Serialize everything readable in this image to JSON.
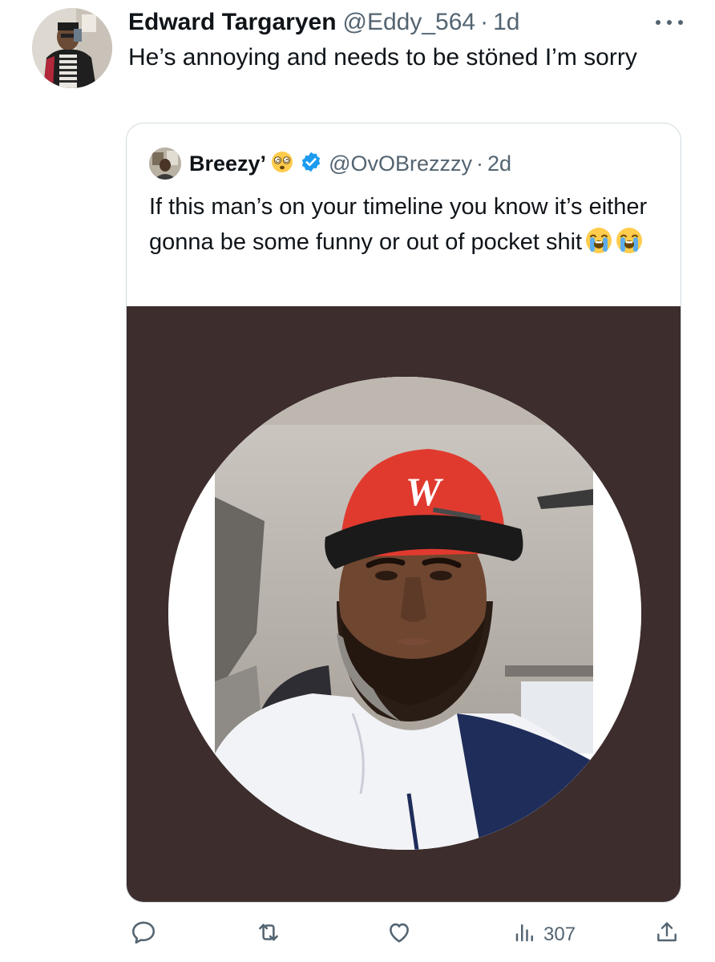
{
  "tweet": {
    "display_name": "Edward Targaryen",
    "handle": "@Eddy_564",
    "separator": "·",
    "time": "1d",
    "text": "He’s annoying and needs to be stöned I’m sorry"
  },
  "quote": {
    "display_name": "Breezy’",
    "handle": "@OvOBrezzzy",
    "separator": "·",
    "time": "2d",
    "text": "If this man’s on your timeline you know it’s either gonna be some funny or out of pocket shit",
    "trailing_emojis": [
      "loudly-crying-face",
      "loudly-crying-face"
    ],
    "name_emoji": "dizzy-face",
    "verified": true,
    "verified_color": "#1d9bf0",
    "media_background": "#3d2d2c",
    "hat_logo": "W"
  },
  "actions": {
    "reply_icon": "reply-icon",
    "retweet_icon": "retweet-icon",
    "like_icon": "heart-icon",
    "views_icon": "views-icon",
    "views_count": "307",
    "share_icon": "share-icon"
  },
  "colors": {
    "text": "#0f1419",
    "secondary": "#536471",
    "border": "#cfd9de"
  }
}
